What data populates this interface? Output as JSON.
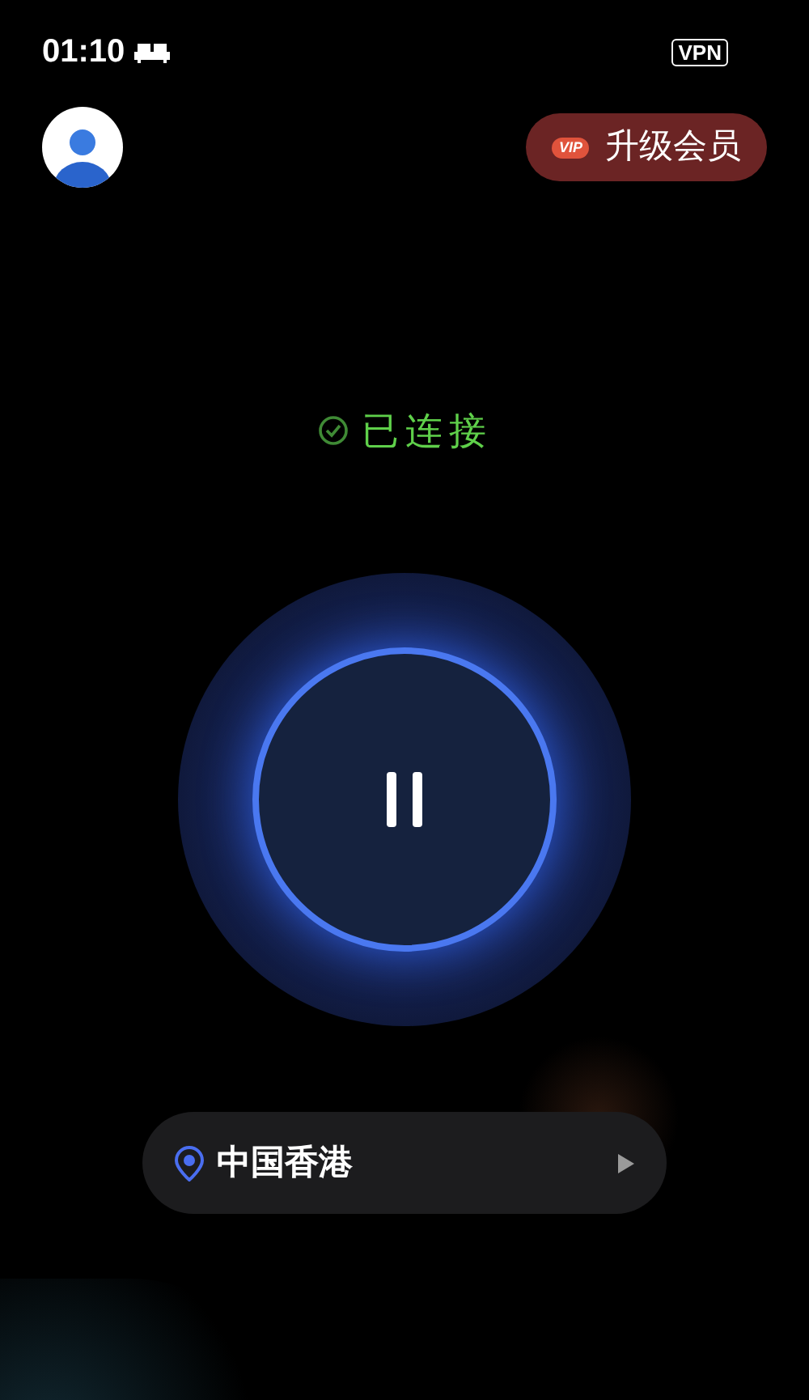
{
  "status_bar": {
    "time": "01:10",
    "vpn_badge": "VPN"
  },
  "header": {
    "vip_badge": "VIP",
    "upgrade_label": "升级会员"
  },
  "connection": {
    "connected": true,
    "status_text": "已连接"
  },
  "location": {
    "name": "中国香港"
  }
}
